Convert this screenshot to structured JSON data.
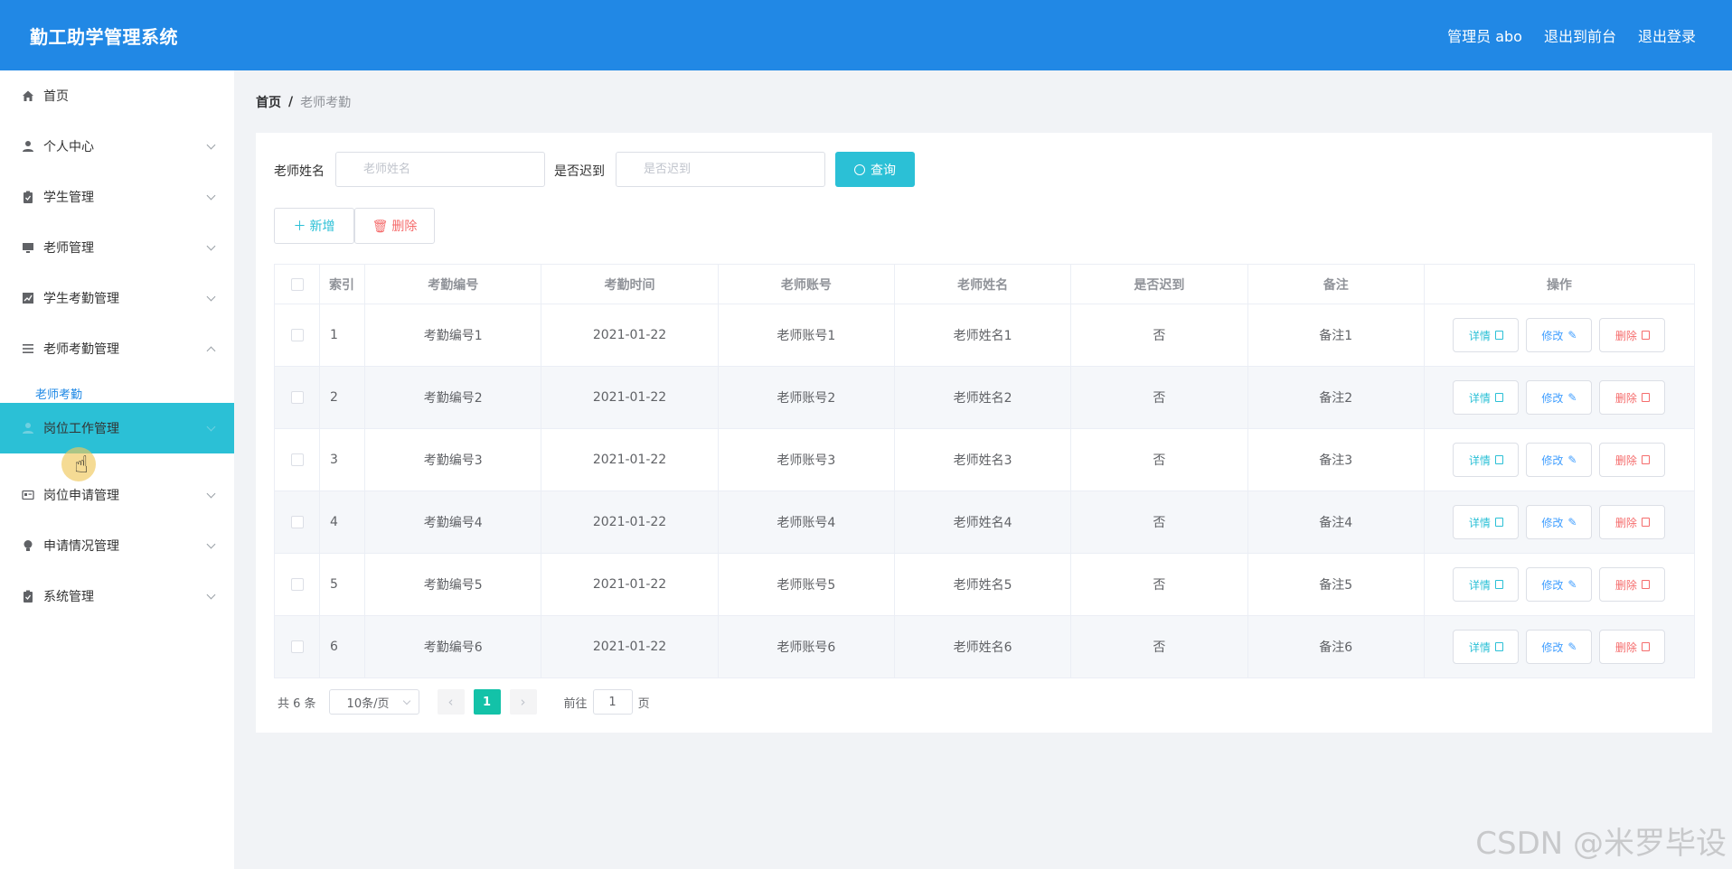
{
  "header": {
    "title": "勤工助学管理系统",
    "user": "管理员 abo",
    "to_front": "退出到前台",
    "logout": "退出登录"
  },
  "colors": {
    "header_bg": "#2188e5",
    "accent": "#2bc0d6",
    "active_page": "#13c2a8",
    "danger": "#f56c6c"
  },
  "sidebar": {
    "items": [
      {
        "label": "首页",
        "icon": "home-icon"
      },
      {
        "label": "个人中心",
        "icon": "user-icon"
      },
      {
        "label": "学生管理",
        "icon": "clipboard-icon"
      },
      {
        "label": "老师管理",
        "icon": "monitor-icon"
      },
      {
        "label": "学生考勤管理",
        "icon": "chart-icon"
      },
      {
        "label": "老师考勤管理",
        "icon": "list-icon"
      },
      {
        "label": "岗位工作管理",
        "icon": "user-icon"
      },
      {
        "label": "岗位申请管理",
        "icon": "id-card-icon"
      },
      {
        "label": "申请情况管理",
        "icon": "bulb-icon"
      },
      {
        "label": "系统管理",
        "icon": "clipboard-icon"
      }
    ],
    "sub_item": "老师考勤"
  },
  "breadcrumb": {
    "home": "首页",
    "sep": "/",
    "current": "老师考勤"
  },
  "filters": {
    "name_label": "老师姓名",
    "name_placeholder": "老师姓名",
    "late_label": "是否迟到",
    "late_placeholder": "是否迟到",
    "query_button": "查询"
  },
  "actions": {
    "add": "新增",
    "delete": "删除"
  },
  "table": {
    "headers": [
      "索引",
      "考勤编号",
      "考勤时间",
      "老师账号",
      "老师姓名",
      "是否迟到",
      "备注",
      "操作"
    ],
    "rows": [
      [
        "1",
        "考勤编号1",
        "2021-01-22",
        "老师账号1",
        "老师姓名1",
        "否",
        "备注1"
      ],
      [
        "2",
        "考勤编号2",
        "2021-01-22",
        "老师账号2",
        "老师姓名2",
        "否",
        "备注2"
      ],
      [
        "3",
        "考勤编号3",
        "2021-01-22",
        "老师账号3",
        "老师姓名3",
        "否",
        "备注3"
      ],
      [
        "4",
        "考勤编号4",
        "2021-01-22",
        "老师账号4",
        "老师姓名4",
        "否",
        "备注4"
      ],
      [
        "5",
        "考勤编号5",
        "2021-01-22",
        "老师账号5",
        "老师姓名5",
        "否",
        "备注5"
      ],
      [
        "6",
        "考勤编号6",
        "2021-01-22",
        "老师账号6",
        "老师姓名6",
        "否",
        "备注6"
      ]
    ],
    "row_actions": {
      "detail": "详情",
      "edit": "修改",
      "delete": "删除"
    }
  },
  "pagination": {
    "total": "共 6 条",
    "page_size": "10条/页",
    "current_page": "1",
    "goto_prefix": "前往",
    "goto_value": "1",
    "goto_suffix": "页"
  },
  "watermark": "CSDN @米罗毕设"
}
